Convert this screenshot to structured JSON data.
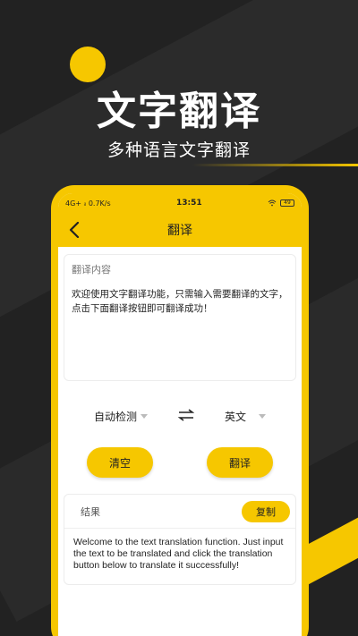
{
  "hero": {
    "title": "文字翻译",
    "subtitle": "多种语言文字翻译"
  },
  "status": {
    "left": "4G+ ᵢₗ 0.7K/s",
    "time": "13:51",
    "wifi": "wifi-icon",
    "battery": "49"
  },
  "nav": {
    "title": "翻译",
    "back_icon": "chevron-left-icon"
  },
  "input": {
    "label": "翻译内容",
    "text": "欢迎使用文字翻译功能，只需输入需要翻译的文字，点击下面翻译按钮即可翻译成功！"
  },
  "lang": {
    "source": "自动检测",
    "target": "英文",
    "swap_icon": "swap-icon"
  },
  "buttons": {
    "clear": "清空",
    "translate": "翻译"
  },
  "result": {
    "label": "结果",
    "copy": "复制",
    "text": "Welcome to the text translation function. Just input the text to be translated and click the translation button below to translate it successfully!"
  },
  "colors": {
    "accent": "#f6c700",
    "background": "#222222"
  }
}
